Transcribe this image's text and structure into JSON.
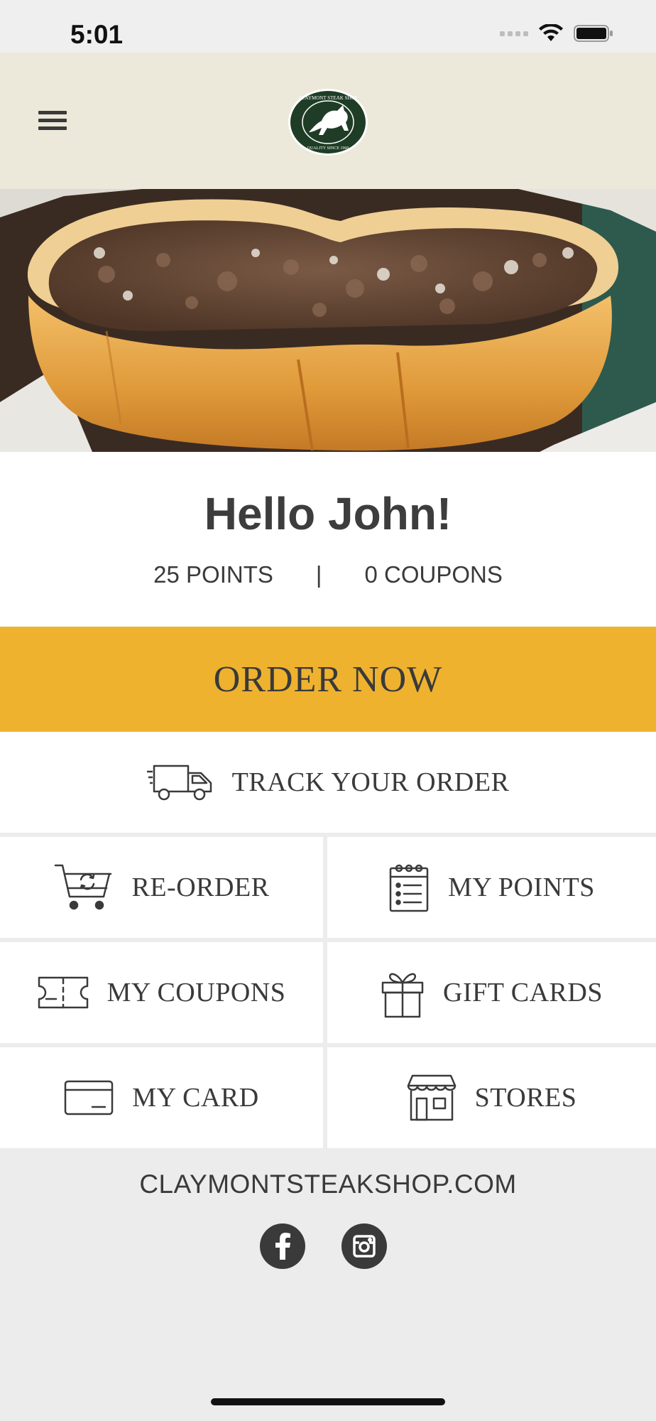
{
  "status": {
    "time": "5:01"
  },
  "header": {
    "logo_text_top": "CLAYMONT STEAK SHOP",
    "logo_text_bottom": "QUALITY SINCE 1960"
  },
  "greeting": {
    "hello": "Hello John!",
    "points": "25 POINTS",
    "separator": "|",
    "coupons": "0 COUPONS"
  },
  "actions": {
    "order_now": "ORDER NOW",
    "track": "TRACK YOUR ORDER",
    "reorder": "RE-ORDER",
    "my_points": "MY POINTS",
    "my_coupons": "MY COUPONS",
    "gift_cards": "GIFT CARDS",
    "my_card": "MY CARD",
    "stores": "STORES"
  },
  "footer": {
    "website": "CLAYMONTSTEAKSHOP.COM"
  },
  "colors": {
    "accent": "#efb22f",
    "header_bg": "#ece8da",
    "logo_green": "#1f3d26",
    "text": "#3a3a3a"
  },
  "icons": [
    "menu-icon",
    "truck-icon",
    "cart-reorder-icon",
    "notepad-icon",
    "coupon-icon",
    "gift-icon",
    "credit-card-icon",
    "storefront-icon",
    "facebook-icon",
    "instagram-icon"
  ]
}
